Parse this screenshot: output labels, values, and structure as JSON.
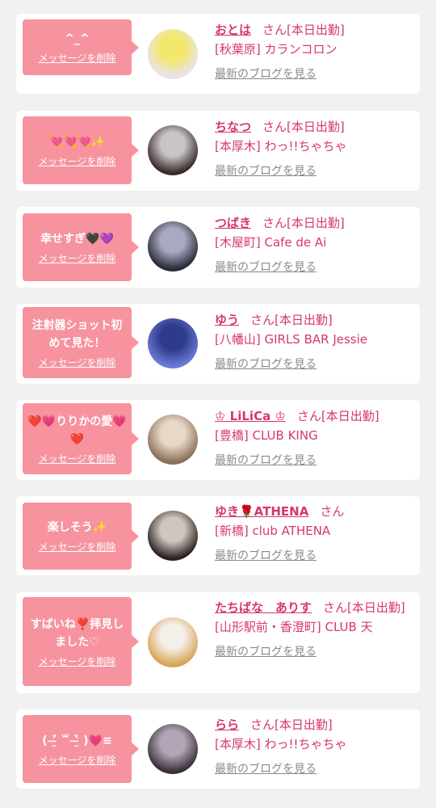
{
  "items": [
    {
      "message": "^_^",
      "delete_label": "メッセージを削除",
      "name": "おとは",
      "suffix": "さん[本日出勤]",
      "shop": "[秋葉原] カランコロン",
      "blog_label": "最新のブログを見る",
      "avatar_colors": [
        "#e9e2ee",
        "#f3e86a"
      ]
    },
    {
      "message": "💘💘💘✨",
      "delete_label": "メッセージを削除",
      "name": "ちなつ",
      "suffix": "さん[本日出勤]",
      "shop": "[本厚木] わっ!!ちゃちゃ",
      "blog_label": "最新のブログを見る",
      "avatar_colors": [
        "#3a2a2a",
        "#c9c4c6"
      ]
    },
    {
      "message": "幸せすぎ🖤💜",
      "delete_label": "メッセージを削除",
      "name": "つばき",
      "suffix": "さん[本日出勤]",
      "shop": "[木屋町] Cafe de Ai",
      "blog_label": "最新のブログを見る",
      "avatar_colors": [
        "#2a2a38",
        "#a7aac0"
      ]
    },
    {
      "message": "注射器ショット初めて見た！",
      "delete_label": "メッセージを削除",
      "name": "ゆう",
      "suffix": "さん[本日出勤]",
      "shop": "[八幡山] GIRLS BAR Jessie",
      "blog_label": "最新のブログを見る",
      "avatar_colors": [
        "#6b7bd6",
        "#2e3a8a"
      ]
    },
    {
      "message": "❤️💗りりかの愛💗❤️",
      "delete_label": "メッセージを削除",
      "name": "♔ LiLiCa ♔",
      "suffix": "さん[本日出勤]",
      "shop": "[豊橋] CLUB KING",
      "blog_label": "最新のブログを見る",
      "avatar_colors": [
        "#8a7058",
        "#e8d8c8"
      ]
    },
    {
      "message": "楽しそう✨",
      "delete_label": "メッセージを削除",
      "name": "ゆき🌹ATHENA",
      "suffix": "さん",
      "shop": "[新橋] club ATHENA",
      "blog_label": "最新のブログを見る",
      "avatar_colors": [
        "#2a2220",
        "#cfc6be"
      ]
    },
    {
      "message": "すばいね❣️拝見しました♡",
      "delete_label": "メッセージを削除",
      "name": "たちばな　ありす",
      "suffix": "さん[本日出勤]",
      "shop": "[山形駅前・香澄町] CLUB 天",
      "blog_label": "最新のブログを見る",
      "avatar_colors": [
        "#d8a55a",
        "#f4efe8"
      ]
    },
    {
      "message": "( ˃̶̤́ ꒳ ˂̶̤̀ )💗≡",
      "delete_label": "メッセージを削除",
      "name": "らら",
      "suffix": "さん[本日出勤]",
      "shop": "[本厚木] わっ!!ちゃちゃ",
      "blog_label": "最新のブログを見る",
      "avatar_colors": [
        "#3c3038",
        "#b0a6b6"
      ]
    }
  ]
}
